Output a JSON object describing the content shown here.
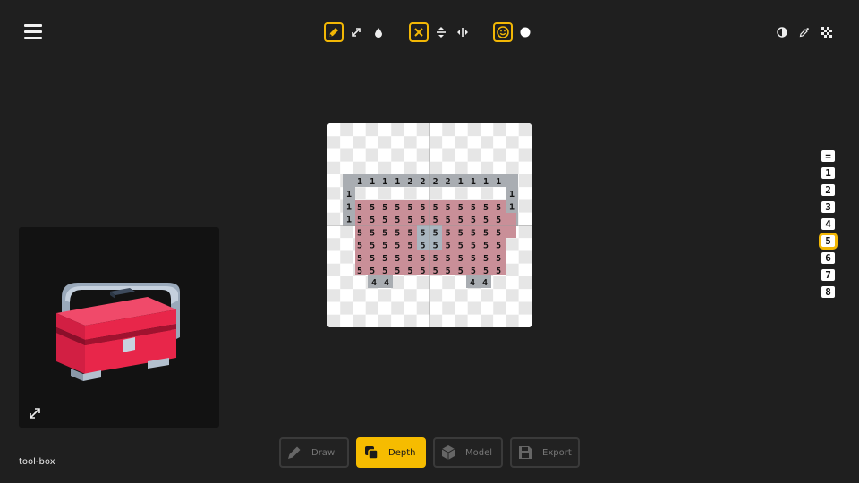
{
  "toolbar": {
    "groups": [
      {
        "tools": [
          {
            "icon": "pencil-icon",
            "active": true
          },
          {
            "icon": "line-diagonal-icon",
            "active": false
          },
          {
            "icon": "fill-drop-icon",
            "active": false
          }
        ]
      },
      {
        "tools": [
          {
            "icon": "clear-x-icon",
            "active": true
          },
          {
            "icon": "mirror-vertical-icon",
            "active": false
          },
          {
            "icon": "mirror-horizontal-icon",
            "active": false
          }
        ]
      },
      {
        "tools": [
          {
            "icon": "smiley-icon",
            "active": true
          },
          {
            "icon": "white-circle-icon",
            "active": false
          }
        ]
      }
    ],
    "right_tools": [
      "contrast-icon",
      "eyedropper-icon",
      "checkerboard-icon"
    ]
  },
  "depth_levels": [
    "=",
    "1",
    "2",
    "3",
    "4",
    "5",
    "6",
    "7",
    "8"
  ],
  "selected_depth": "5",
  "preview": {
    "expand_icon": "expand-icon"
  },
  "file_name": "tool-box",
  "modes": [
    {
      "label": "Draw",
      "icon": "pencil-icon",
      "active": false
    },
    {
      "label": "Depth",
      "icon": "layers-icon",
      "active": true
    },
    {
      "label": "Model",
      "icon": "cube-icon",
      "active": false
    },
    {
      "label": "Export",
      "icon": "save-icon",
      "active": false
    }
  ],
  "canvas": {
    "row_handle": [
      "1",
      "1",
      "1",
      "1",
      "2",
      "2",
      "2",
      "2",
      "1",
      "1",
      "1",
      "1"
    ],
    "body_digit": "5",
    "foot_digit": "4"
  },
  "colors": {
    "accent": "#f2b705",
    "background": "#1f1f1f",
    "box_red": "#e8264a",
    "handle_gray": "#9aa9ba"
  }
}
